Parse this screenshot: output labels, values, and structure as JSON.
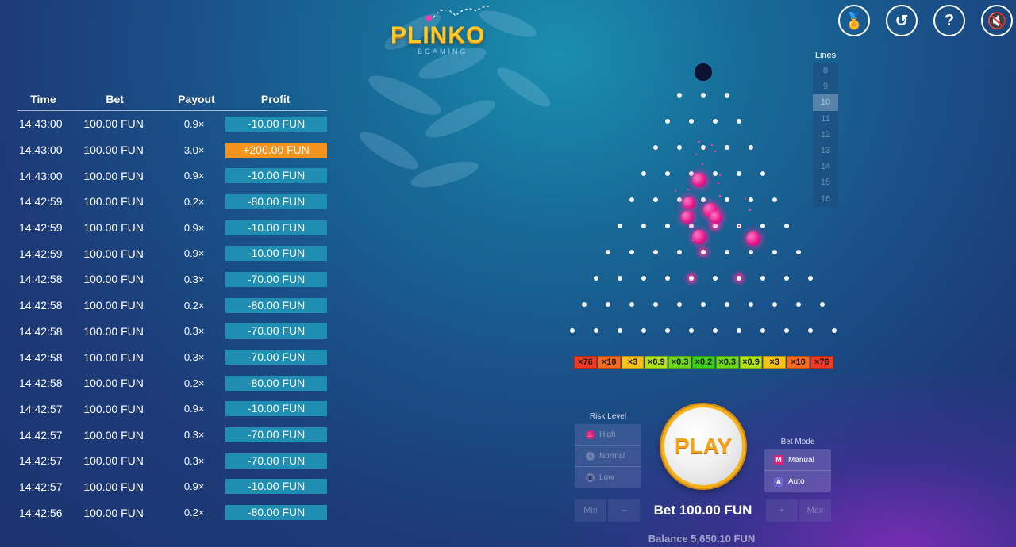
{
  "logo": {
    "title": "PLINKO",
    "subtitle": "BGAMING"
  },
  "top_buttons": [
    {
      "name": "achievements-icon",
      "glyph": "🏅"
    },
    {
      "name": "history-icon",
      "glyph": "↺"
    },
    {
      "name": "help-icon",
      "glyph": "?"
    },
    {
      "name": "sound-muted-icon",
      "glyph": "🔇"
    }
  ],
  "history": {
    "headers": [
      "Time",
      "Bet",
      "Payout",
      "Profit"
    ],
    "rows": [
      {
        "time": "14:43:00",
        "bet": "100.00 FUN",
        "payout": "0.9×",
        "profit": "-10.00 FUN",
        "win": false
      },
      {
        "time": "14:43:00",
        "bet": "100.00 FUN",
        "payout": "3.0×",
        "profit": "+200.00 FUN",
        "win": true
      },
      {
        "time": "14:43:00",
        "bet": "100.00 FUN",
        "payout": "0.9×",
        "profit": "-10.00 FUN",
        "win": false
      },
      {
        "time": "14:42:59",
        "bet": "100.00 FUN",
        "payout": "0.2×",
        "profit": "-80.00 FUN",
        "win": false
      },
      {
        "time": "14:42:59",
        "bet": "100.00 FUN",
        "payout": "0.9×",
        "profit": "-10.00 FUN",
        "win": false
      },
      {
        "time": "14:42:59",
        "bet": "100.00 FUN",
        "payout": "0.9×",
        "profit": "-10.00 FUN",
        "win": false
      },
      {
        "time": "14:42:58",
        "bet": "100.00 FUN",
        "payout": "0.3×",
        "profit": "-70.00 FUN",
        "win": false
      },
      {
        "time": "14:42:58",
        "bet": "100.00 FUN",
        "payout": "0.2×",
        "profit": "-80.00 FUN",
        "win": false
      },
      {
        "time": "14:42:58",
        "bet": "100.00 FUN",
        "payout": "0.3×",
        "profit": "-70.00 FUN",
        "win": false
      },
      {
        "time": "14:42:58",
        "bet": "100.00 FUN",
        "payout": "0.3×",
        "profit": "-70.00 FUN",
        "win": false
      },
      {
        "time": "14:42:58",
        "bet": "100.00 FUN",
        "payout": "0.2×",
        "profit": "-80.00 FUN",
        "win": false
      },
      {
        "time": "14:42:57",
        "bet": "100.00 FUN",
        "payout": "0.9×",
        "profit": "-10.00 FUN",
        "win": false
      },
      {
        "time": "14:42:57",
        "bet": "100.00 FUN",
        "payout": "0.3×",
        "profit": "-70.00 FUN",
        "win": false
      },
      {
        "time": "14:42:57",
        "bet": "100.00 FUN",
        "payout": "0.3×",
        "profit": "-70.00 FUN",
        "win": false
      },
      {
        "time": "14:42:57",
        "bet": "100.00 FUN",
        "payout": "0.9×",
        "profit": "-10.00 FUN",
        "win": false
      },
      {
        "time": "14:42:56",
        "bet": "100.00 FUN",
        "payout": "0.2×",
        "profit": "-80.00 FUN",
        "win": false
      }
    ]
  },
  "board": {
    "rows": 10
  },
  "multipliers": [
    {
      "label": "×76",
      "color": "#f03a24"
    },
    {
      "label": "×10",
      "color": "#f56a1e"
    },
    {
      "label": "×3",
      "color": "#f5c21a"
    },
    {
      "label": "×0.9",
      "color": "#b4e21a"
    },
    {
      "label": "×0.3",
      "color": "#6ed61a"
    },
    {
      "label": "×0.2",
      "color": "#3ccf1a"
    },
    {
      "label": "×0.3",
      "color": "#6ed61a"
    },
    {
      "label": "×0.9",
      "color": "#b4e21a"
    },
    {
      "label": "×3",
      "color": "#f5c21a"
    },
    {
      "label": "×10",
      "color": "#f56a1e"
    },
    {
      "label": "×76",
      "color": "#f03a24"
    }
  ],
  "lines": {
    "label": "Lines",
    "options": [
      "8",
      "9",
      "10",
      "11",
      "12",
      "13",
      "14",
      "15",
      "16"
    ],
    "selected": "10"
  },
  "risk": {
    "label": "Risk Level",
    "options": [
      {
        "label": "High",
        "icon": "flame-icon",
        "glyph": "♨",
        "selected": true
      },
      {
        "label": "Normal",
        "icon": "gauge-icon",
        "glyph": "◔",
        "selected": false
      },
      {
        "label": "Low",
        "icon": "lock-icon",
        "glyph": "▣",
        "selected": false
      }
    ]
  },
  "bet_mode": {
    "label": "Bet Mode",
    "options": [
      {
        "label": "Manual",
        "badge": "M"
      },
      {
        "label": "Auto",
        "badge": "A"
      }
    ]
  },
  "play_label": "PLAY",
  "bet": {
    "min_label": "Min",
    "minus_label": "−",
    "plus_label": "+",
    "max_label": "Max",
    "text": "Bet 100.00 FUN"
  },
  "balance_text": "Balance 5,650.10 FUN"
}
